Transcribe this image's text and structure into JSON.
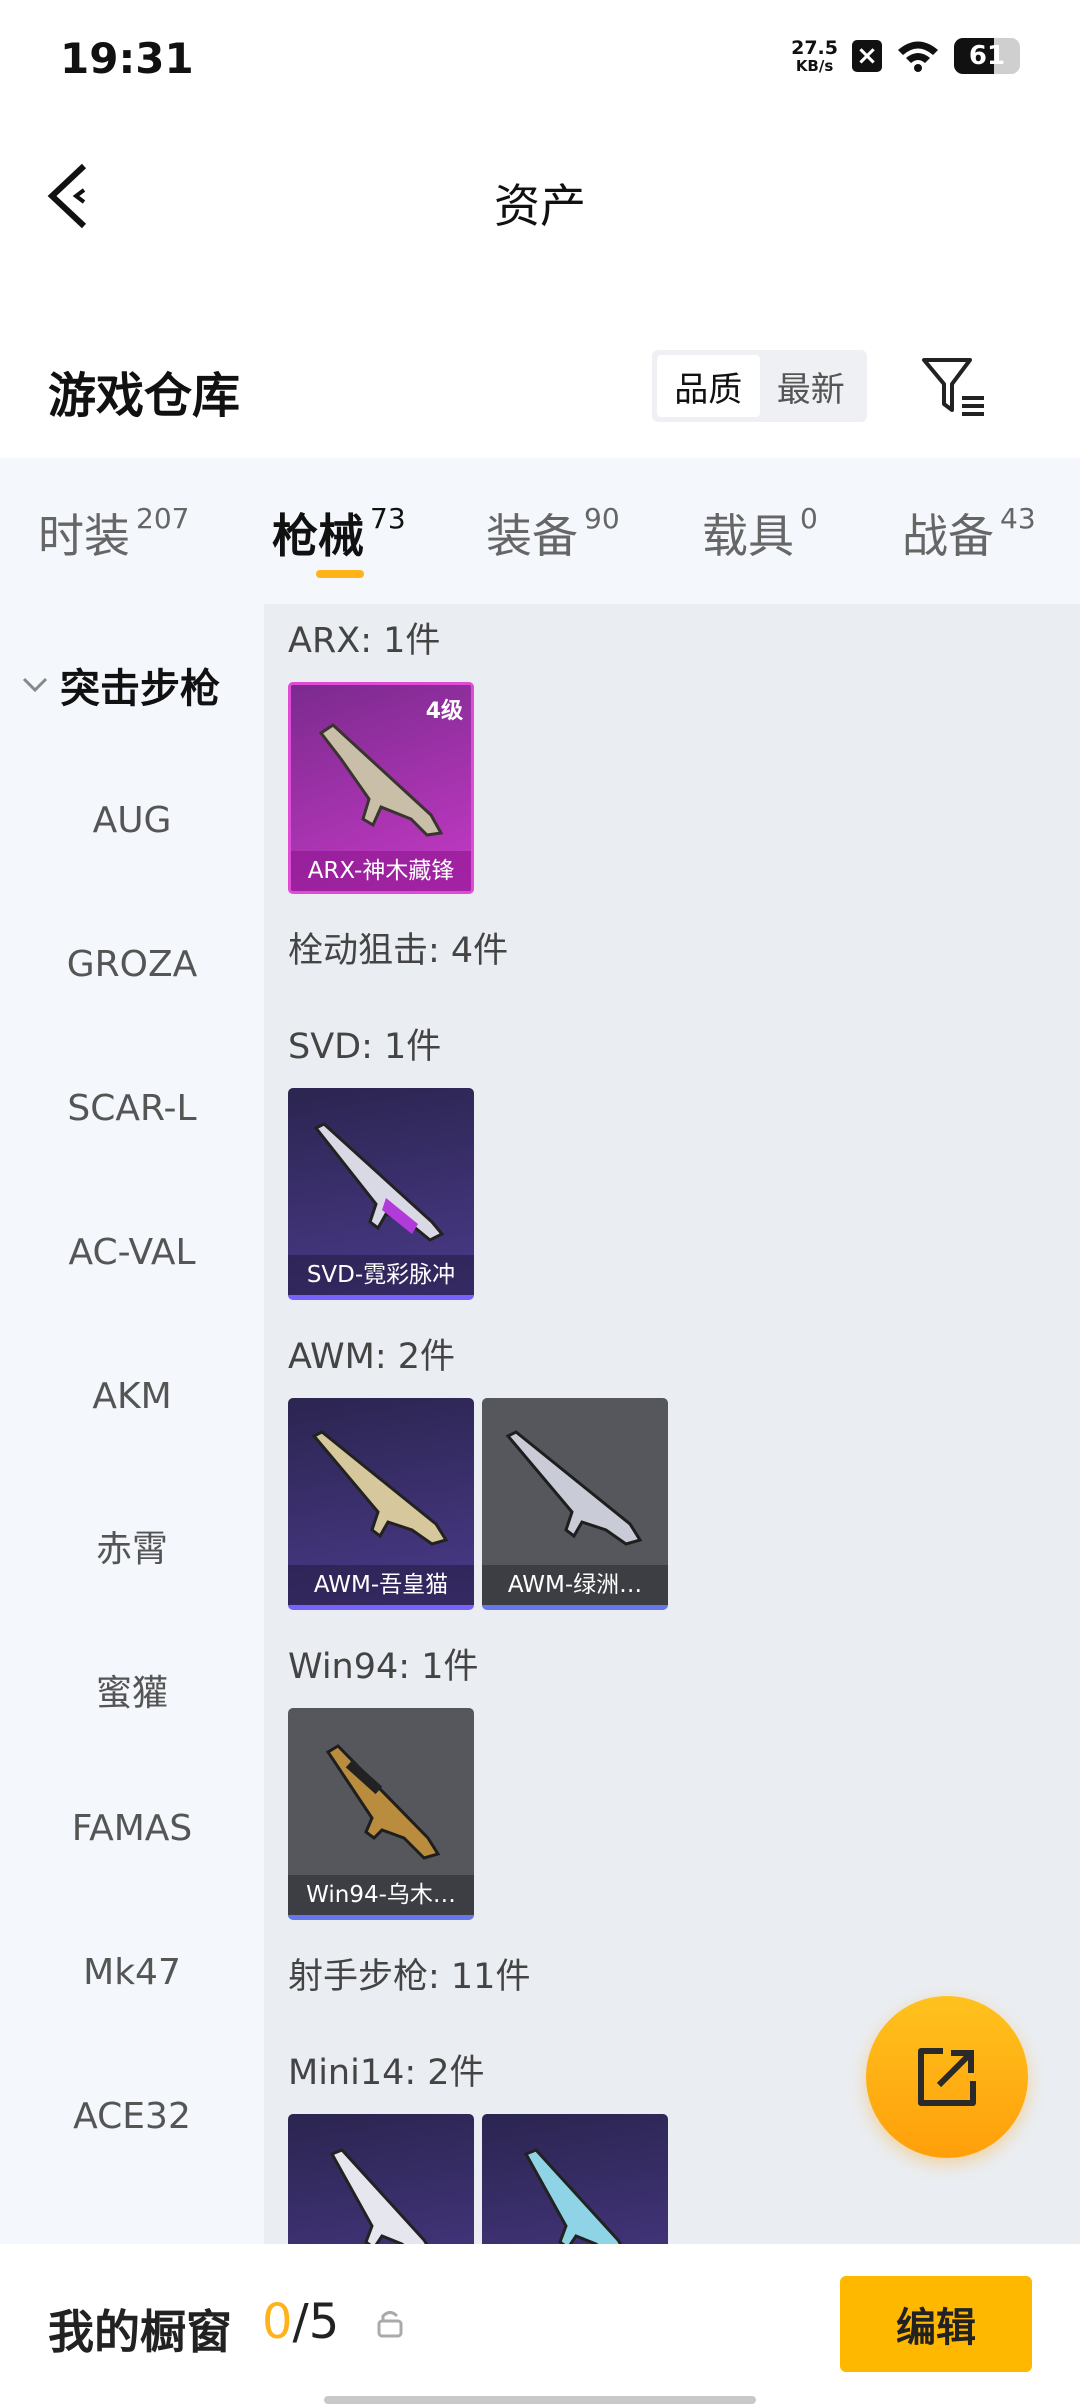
{
  "status_bar": {
    "time": "19:31",
    "net_speed_value": "27.5",
    "net_speed_unit": "KB/s",
    "battery": "61",
    "battery_level_percent": 61
  },
  "nav": {
    "title": "资产"
  },
  "warehouse": {
    "title": "游戏仓库",
    "sort_options": [
      "品质",
      "最新"
    ],
    "sort_selected": "品质"
  },
  "tabs": [
    {
      "label": "时装",
      "count": "207"
    },
    {
      "label": "枪械",
      "count": "73"
    },
    {
      "label": "装备",
      "count": "90"
    },
    {
      "label": "载具",
      "count": "0"
    },
    {
      "label": "战备",
      "count": "43"
    }
  ],
  "active_tab": "枪械",
  "side_menu": {
    "group": "突击步枪",
    "items": [
      "AUG",
      "GROZA",
      "SCAR-L",
      "AC-VAL",
      "AKM",
      "赤霄",
      "蜜獾",
      "FAMAS",
      "Mk47",
      "ACE32"
    ]
  },
  "content": {
    "groups": [
      {
        "label": "ARX: 1件",
        "items": [
          {
            "name": "ARX-神木藏锋",
            "level": "4级",
            "rarity": "pink"
          }
        ]
      },
      {
        "label": "栓动狙击: 4件",
        "items": []
      },
      {
        "label": "SVD: 1件",
        "items": [
          {
            "name": "SVD-霓彩脉冲",
            "rarity": "purple"
          }
        ]
      },
      {
        "label": "AWM: 2件",
        "items": [
          {
            "name": "AWM-吾皇猫",
            "rarity": "purple"
          },
          {
            "name": "AWM-绿洲…",
            "rarity": "gray"
          }
        ]
      },
      {
        "label": "Win94: 1件",
        "items": [
          {
            "name": "Win94-乌木…",
            "rarity": "gray"
          }
        ]
      },
      {
        "label": "射手步枪: 11件",
        "items": []
      },
      {
        "label": "Mini14: 2件",
        "items": [
          {
            "name": "",
            "rarity": "purple"
          },
          {
            "name": "",
            "rarity": "purple"
          }
        ]
      }
    ]
  },
  "bottom_bar": {
    "title": "我的橱窗",
    "count_current": "0",
    "count_sep_total": "/5",
    "edit_label": "编辑"
  },
  "colors": {
    "accent": "#ffb800",
    "pink_rarity": "#c63ac7",
    "purple_rarity": "#4b3a8a",
    "gray_rarity": "#55575d"
  }
}
